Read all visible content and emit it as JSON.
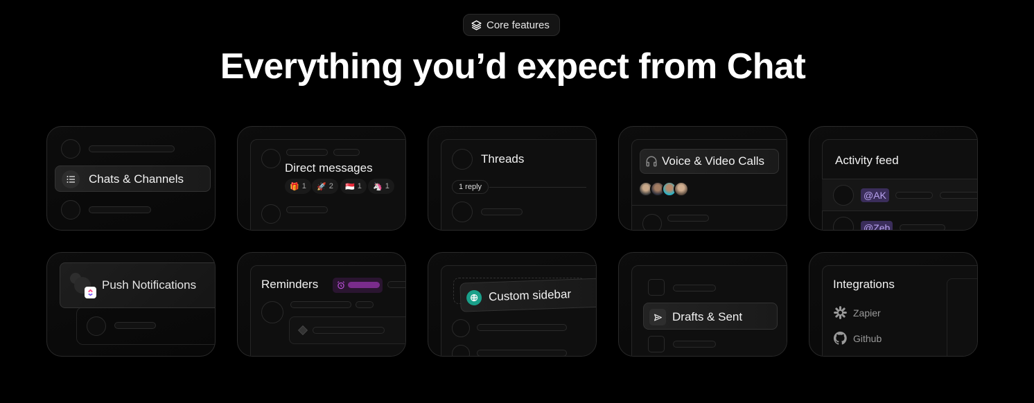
{
  "badge": {
    "label": "Core features",
    "icon": "layers-icon"
  },
  "headline": "Everything you’d expect from Chat",
  "cards": {
    "chats": {
      "label": "Chats & Channels",
      "icon": "list-icon"
    },
    "dm": {
      "label": "Direct messages",
      "reactions": [
        {
          "emoji": "🎁",
          "count": "1"
        },
        {
          "emoji": "🚀",
          "count": "2"
        },
        {
          "emoji": "🇸🇬",
          "count": "1"
        },
        {
          "emoji": "🦄",
          "count": "1"
        }
      ]
    },
    "threads": {
      "label": "Threads",
      "reply": "1 reply"
    },
    "calls": {
      "label": "Voice & Video Calls",
      "icon": "headphones-icon"
    },
    "activity": {
      "label": "Activity feed",
      "mentions": [
        "@AK",
        "@Zeb"
      ]
    },
    "push": {
      "label": "Push Notifications"
    },
    "reminders": {
      "label": "Reminders",
      "accent": "#7a2c8c"
    },
    "sidebar": {
      "label": "Custom sidebar",
      "accent": "#1aa08a"
    },
    "drafts": {
      "label": "Drafts & Sent",
      "icon": "send-icon"
    },
    "integrations": {
      "label": "Integrations",
      "items": [
        {
          "name": "Zapier",
          "icon": "zapier-icon"
        },
        {
          "name": "Github",
          "icon": "github-icon"
        }
      ]
    }
  }
}
